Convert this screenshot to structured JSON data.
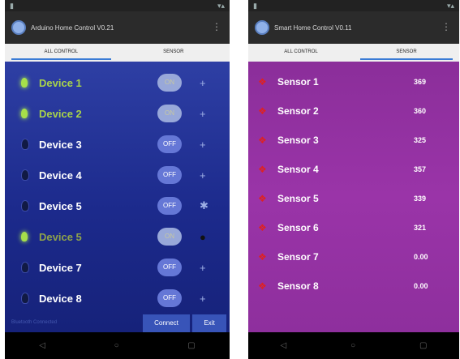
{
  "left": {
    "title": "Arduino Home Control V0.21",
    "tabs": [
      "ALL CONTROL",
      "SENSOR"
    ],
    "devices": [
      {
        "name": "Device 1",
        "toggle": "ON",
        "state": "on",
        "action": "+"
      },
      {
        "name": "Device 2",
        "toggle": "ON",
        "state": "on",
        "action": "+"
      },
      {
        "name": "Device 3",
        "toggle": "OFF",
        "state": "off",
        "action": "+"
      },
      {
        "name": "Device 4",
        "toggle": "OFF",
        "state": "off",
        "action": "+"
      },
      {
        "name": "Device 5",
        "toggle": "OFF",
        "state": "off",
        "action": "✱"
      },
      {
        "name": "Device 5",
        "toggle": "ON",
        "state": "on",
        "action": "●"
      },
      {
        "name": "Device 7",
        "toggle": "OFF",
        "state": "off",
        "action": "+"
      },
      {
        "name": "Device 8",
        "toggle": "OFF",
        "state": "off",
        "action": "+"
      }
    ],
    "status_text": "Bluetooth Connected",
    "connect_label": "Connect",
    "exit_label": "Exit"
  },
  "right": {
    "title": "Smart Home Control V0.11",
    "tabs": [
      "ALL CONTROL",
      "SENSOR"
    ],
    "sensors": [
      {
        "name": "Sensor 1",
        "value": "369"
      },
      {
        "name": "Sensor 2",
        "value": "360"
      },
      {
        "name": "Sensor 3",
        "value": "325"
      },
      {
        "name": "Sensor 4",
        "value": "357"
      },
      {
        "name": "Sensor 5",
        "value": "339"
      },
      {
        "name": "Sensor 6",
        "value": "321"
      },
      {
        "name": "Sensor 7",
        "value": "0.00"
      },
      {
        "name": "Sensor 8",
        "value": "0.00"
      }
    ]
  },
  "colors": {
    "device_bg": "#1c2a8c",
    "sensor_bg": "#9a34a8",
    "accent": "#3a7bd5",
    "bulb_on": "#a6e04a"
  },
  "icons": {
    "app": "app-logo-icon",
    "bulb": "bulb-icon",
    "sensor": "sensor-icon",
    "nav_back": "back-icon",
    "nav_home": "home-icon",
    "nav_recent": "recent-apps-icon"
  }
}
